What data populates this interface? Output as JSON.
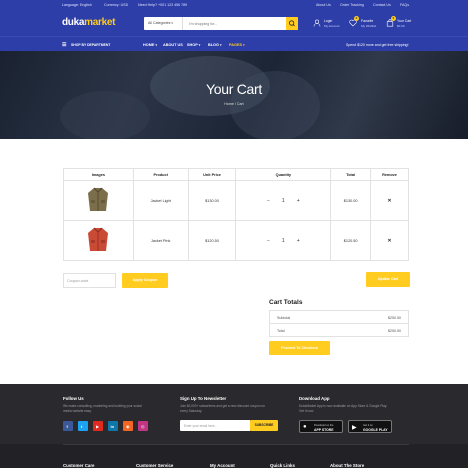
{
  "topbar": {
    "language": "Language: English",
    "currency": "Currency: USD",
    "help": "Need Help? +001 123 456 789",
    "links": [
      "About Us",
      "Order Tracking",
      "Contact Us",
      "FAQs"
    ]
  },
  "header": {
    "logo_prefix": "duka",
    "logo_suffix": "market",
    "search_category": "All Categories",
    "search_placeholder": "I'm shopping for...",
    "account_label": "Login",
    "account_sub": "My Account",
    "wishlist_label": "Favorite",
    "wishlist_sub": "My Wishlist",
    "wishlist_count": "0",
    "cart_label": "Your Cart",
    "cart_sub": "$0.00",
    "cart_count": "0"
  },
  "nav": {
    "department": "SHOP BY DEPARTMENT",
    "items": [
      "HOME",
      "ABOUT US",
      "SHOP",
      "BLOG",
      "PAGES"
    ],
    "promo": "Spend $120 more and get free shipping!"
  },
  "hero": {
    "title": "Your Cart",
    "crumb_home": "Home",
    "crumb_sep": "/",
    "crumb_current": "Cart"
  },
  "cart": {
    "headers": [
      "Images",
      "Product",
      "Unit Price",
      "Quantity",
      "Total",
      "Remove"
    ],
    "rows": [
      {
        "product": "Jacket Light",
        "unit_price": "$130.00",
        "qty": "1",
        "total": "$130.00",
        "remove": "✕"
      },
      {
        "product": "Jacket Pink",
        "unit_price": "$120.50",
        "qty": "1",
        "total": "$120.50",
        "remove": "✕"
      }
    ],
    "qty_minus": "−",
    "qty_plus": "+"
  },
  "actions": {
    "coupon_placeholder": "Coupon code",
    "apply": "Apply Coupon",
    "update": "Update Cart"
  },
  "totals": {
    "title": "Cart Totals",
    "subtotal_label": "Subtotal",
    "subtotal_value": "$250.50",
    "total_label": "Total",
    "total_value": "$250.50",
    "checkout": "Proceed To Checkout"
  },
  "footer": {
    "follow_title": "Follow Us",
    "follow_text_1": "We make consulting, marketing and building your social",
    "follow_text_2": "media website easy.",
    "newsletter_title": "Sign Up To Newsletter",
    "newsletter_text_1": "Join 60,000+ subscribers and get a new discount coupon on",
    "newsletter_text_2": "every Saturday.",
    "newsletter_placeholder": "Enter your email here...",
    "subscribe": "SUBSCRIBE",
    "app_title": "Download App",
    "app_text_1": "DukaMarket App is now available on App Store & Google Play.",
    "app_text_2": "Get it now.",
    "appstore_small": "Download on the",
    "appstore": "APP STORE",
    "gplay_small": "Get it on",
    "gplay": "GOOGLE PLAY",
    "columns": [
      "Customer Care",
      "Customer Service",
      "My Account",
      "Quick Links",
      "About The Store"
    ]
  },
  "colors": {
    "brand_blue": "#2d3ea8",
    "accent_yellow": "#ffcc1f",
    "footer_dark": "#2a2a2e"
  },
  "social_icons": [
    "facebook-icon",
    "twitter-icon",
    "youtube-icon",
    "linkedin-icon",
    "rss-icon",
    "instagram-icon"
  ]
}
